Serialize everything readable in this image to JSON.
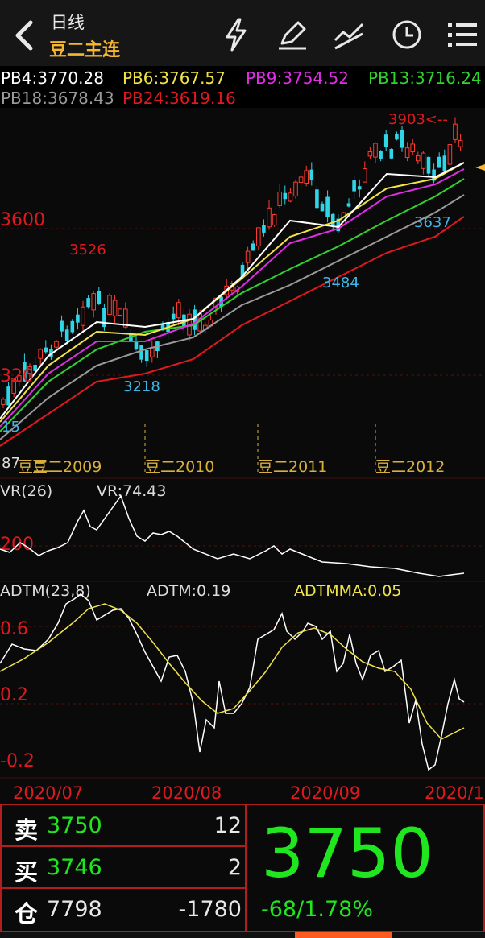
{
  "header": {
    "back_icon": "chevron-left-icon",
    "period": "日线",
    "contract": "豆二主连",
    "toolbar_icons": [
      "lightning-icon",
      "pen-icon",
      "draw-line-icon",
      "clock-icon",
      "menu-list-icon"
    ]
  },
  "indicators": {
    "pb4": "PB4:3770.28",
    "pb6": "PB6:3767.57",
    "pb9": "PB9:3754.52",
    "pb13": "PB13:3716.24",
    "pb18": "PB18:3678.43",
    "pb24": "PB24:3619.16",
    "colors": {
      "pb4": "#ffffff",
      "pb6": "#f0e44a",
      "pb9": "#e02ee6",
      "pb13": "#30d22f",
      "pb18": "#9a9a9a",
      "pb24": "#e0191f"
    }
  },
  "main_chart": {
    "axis_labels": [
      "3600",
      "320",
      "15",
      "87"
    ],
    "price_marks": [
      "3526",
      "3218",
      "3484",
      "3637",
      "3903<--"
    ],
    "contract_switches": [
      "豆二2009",
      "豆二2010",
      "豆二2011",
      "豆二2012"
    ],
    "contract_overlap_label": "豆二"
  },
  "vr_panel": {
    "title": "VR(26)",
    "value": "VR:74.43",
    "axis_label": "200"
  },
  "adtm_panel": {
    "title": "ADTM(23,8)",
    "adtm": "ADTM:0.19",
    "adtmma": "ADTMMA:0.05",
    "axis_labels": [
      "0.6",
      "0.2",
      "-0.2"
    ]
  },
  "dates": [
    "2020/07",
    "2020/08",
    "2020/09",
    "2020/1"
  ],
  "chart_data": {
    "type": "candlestick",
    "title": "豆二主连",
    "period": "日线",
    "moving_averages": {
      "PB4": 3770.28,
      "PB6": 3767.57,
      "PB9": 3754.52,
      "PB13": 3716.24,
      "PB18": 3678.43,
      "PB24": 3619.16
    },
    "marked_highs_lows": [
      3526,
      3218,
      3484,
      3637,
      3903
    ],
    "VR": 74.43,
    "ADTM": 0.19,
    "ADTMMA": 0.05
  },
  "quote": {
    "sell_label": "卖",
    "sell_price": "3750",
    "sell_vol": "12",
    "buy_label": "买",
    "buy_price": "3746",
    "buy_vol": "2",
    "oi_label": "仓",
    "oi": "7798",
    "oi_change": "-1780",
    "last": "3750",
    "change": "-68/1.78%",
    "colors": {
      "up": "#ff3b30",
      "down": "#1fe61f",
      "frame": "#b21e1e"
    }
  }
}
